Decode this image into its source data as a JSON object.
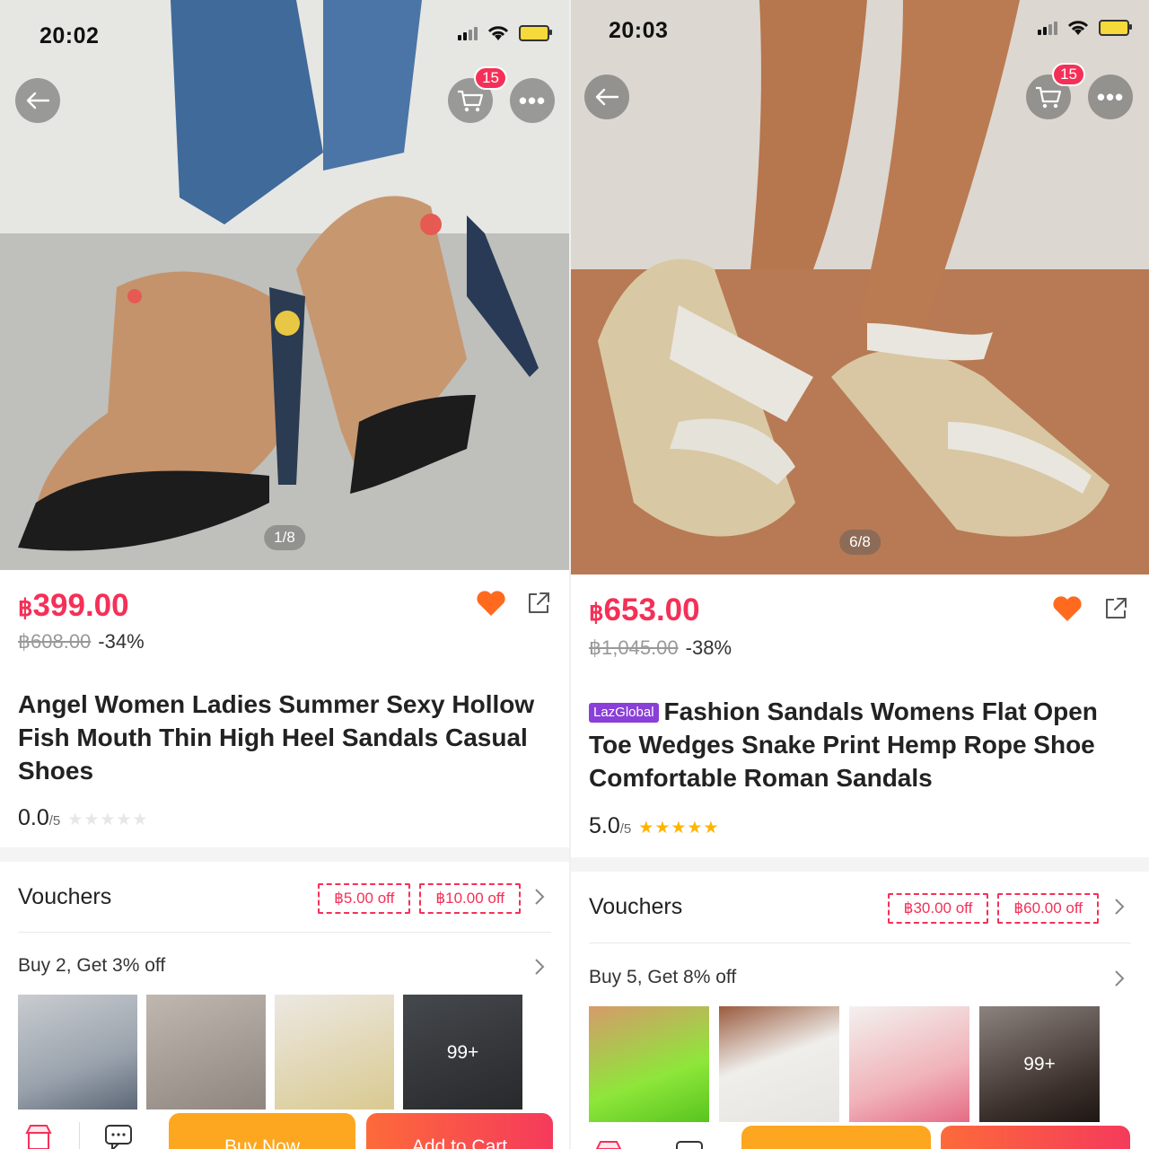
{
  "left": {
    "status_time": "20:02",
    "cart_count": "15",
    "image_counter": "1/8",
    "price_symbol": "฿",
    "price": "399.00",
    "original_price": "฿608.00",
    "discount": "-34%",
    "title": "Angel Women Ladies Summer Sexy Hollow Fish Mouth Thin High Heel Sandals Casual Shoes",
    "rating_value": "0.0",
    "rating_scale": "/5",
    "rating_stars": "★★★★★",
    "vouchers_label": "Vouchers",
    "vouchers": [
      "฿5.00 off",
      "฿10.00 off"
    ],
    "promo_label": "Buy 2, Get 3% off",
    "more_count": "99+",
    "buy_now": "Buy Now",
    "add_to_cart": "Add to Cart"
  },
  "right": {
    "status_time": "20:03",
    "cart_count": "15",
    "image_counter": "6/8",
    "price_symbol": "฿",
    "price": "653.00",
    "original_price": "฿1,045.00",
    "discount": "-38%",
    "badge": "LazGlobal",
    "title": "Fashion Sandals Womens Flat Open Toe Wedges Snake Print Hemp Rope Shoe Comfortable Roman Sandals",
    "rating_value": "5.0",
    "rating_scale": "/5",
    "rating_stars": "★★★★★",
    "vouchers_label": "Vouchers",
    "vouchers": [
      "฿30.00 off",
      "฿60.00 off"
    ],
    "promo_label": "Buy 5, Get 8% off",
    "more_count": "99+"
  },
  "colors": {
    "accent": "#f53057",
    "heart": "#ff6a1f",
    "buy_now": "#fca71f",
    "add_to_cart": "#f53a5c",
    "star_filled": "#ffb400",
    "badge_lazglobal": "#8a3fd8"
  },
  "icons": [
    "back-arrow-icon",
    "cart-icon",
    "more-icon",
    "heart-icon",
    "share-icon",
    "chevron-right-icon",
    "store-icon",
    "chat-icon",
    "wifi-icon",
    "battery-icon",
    "signal-icon"
  ]
}
